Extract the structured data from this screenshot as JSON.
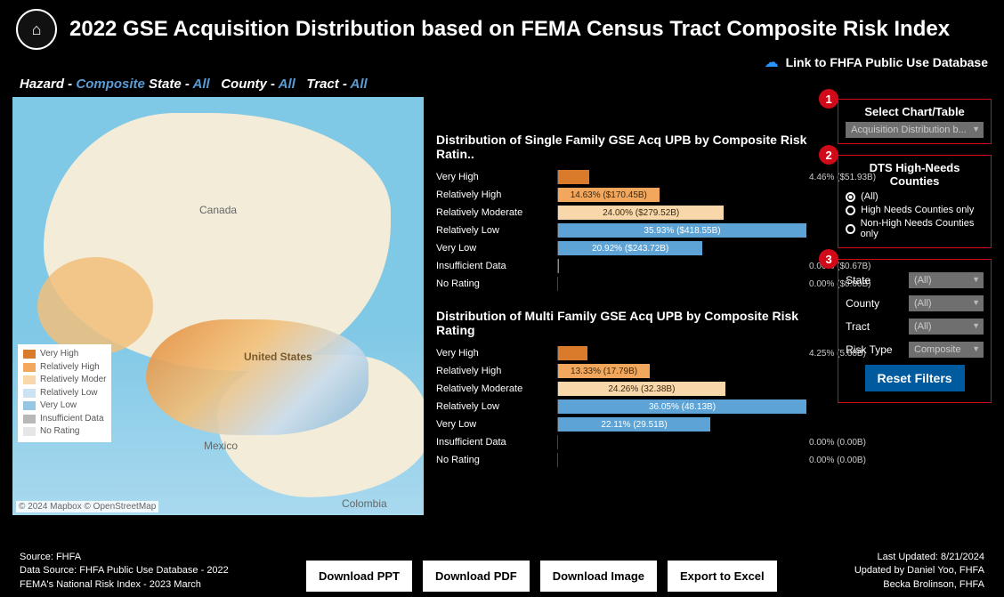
{
  "header": {
    "title": "2022 GSE Acquisition Distribution based on FEMA Census Tract Composite Risk Index",
    "link_label": "Link to FHFA Public Use Database"
  },
  "breadcrumb": {
    "hazard_lbl": "Hazard -",
    "hazard_val": "Composite",
    "state_lbl": "State -",
    "state_val": "All",
    "county_lbl": "County -",
    "county_val": "All",
    "tract_lbl": "Tract -",
    "tract_val": "All"
  },
  "map": {
    "labels": {
      "canada": "Canada",
      "usa": "United States",
      "mexico": "Mexico",
      "colombia": "Colombia"
    },
    "legend": [
      "Very High",
      "Relatively High",
      "Relatively Moder",
      "Relatively Low",
      "Very Low",
      "Insufficient Data",
      "No Rating"
    ],
    "legend_colors": [
      "#d97b2b",
      "#f2a75d",
      "#f8d7aa",
      "#cde3f1",
      "#96c6e4",
      "#b8b8b8",
      "#e6e6e6"
    ],
    "attrib": "© 2024 Mapbox  © OpenStreetMap"
  },
  "chart_data": [
    {
      "type": "bar",
      "title": "Distribution of Single Family GSE Acq UPB by Composite Risk Ratin..",
      "categories": [
        "Very High",
        "Relatively High",
        "Relatively Moderate",
        "Relatively Low",
        "Very Low",
        "Insufficient Data",
        "No Rating"
      ],
      "percent": [
        4.46,
        14.63,
        24.0,
        35.93,
        20.92,
        0.06,
        0.0
      ],
      "amount_b": [
        51.93,
        170.45,
        279.52,
        418.55,
        243.72,
        0.67,
        0.0
      ],
      "colors": [
        "#d97b2b",
        "#f2a75d",
        "#f8d7aa",
        "#5ea3d6",
        "#5ea3d6",
        "#888",
        "#888"
      ],
      "labels": [
        "4.46% ($51.93B)",
        "14.63% ($170.45B)",
        "24.00% ($279.52B)",
        "35.93% ($418.55B)",
        "20.92% ($243.72B)",
        "0.06% ($0.67B)",
        "0.00% ($0.00B)"
      ]
    },
    {
      "type": "bar",
      "title": "Distribution of Multi Family GSE Acq UPB by Composite Risk Rating",
      "categories": [
        "Very High",
        "Relatively High",
        "Relatively Moderate",
        "Relatively Low",
        "Very Low",
        "Insufficient Data",
        "No Rating"
      ],
      "percent": [
        4.25,
        13.33,
        24.26,
        36.05,
        22.11,
        0.0,
        0.0
      ],
      "amount_b": [
        5.68,
        17.79,
        32.38,
        48.13,
        29.51,
        0.0,
        0.0
      ],
      "colors": [
        "#d97b2b",
        "#f2a75d",
        "#f8d7aa",
        "#5ea3d6",
        "#5ea3d6",
        "#888",
        "#888"
      ],
      "labels": [
        "4.25% (5.68B)",
        "13.33% (17.79B)",
        "24.26% (32.38B)",
        "36.05% (48.13B)",
        "22.11% (29.51B)",
        "0.00% (0.00B)",
        "0.00% (0.00B)"
      ]
    }
  ],
  "panels": {
    "select_title": "Select Chart/Table",
    "select_value": "Acquisition Distribution b...",
    "dts_title": "DTS High-Needs Counties",
    "dts_options": [
      "(All)",
      "High Needs Counties only",
      "Non-High Needs Counties only"
    ],
    "dts_selected": 0,
    "filters": {
      "state_lbl": "State",
      "state_val": "(All)",
      "county_lbl": "County",
      "county_val": "(All)",
      "tract_lbl": "Tract",
      "tract_val": "(All)",
      "risktype_lbl": "Risk Type",
      "risktype_val": "Composite"
    },
    "reset_label": "Reset Filters"
  },
  "footer": {
    "source1": "Source:  FHFA",
    "source2": "Data Source: FHFA Public Use Database -  2022",
    "source3": "FEMA's National Risk Index - 2023 March",
    "btns": [
      "Download PPT",
      "Download PDF",
      "Download Image",
      "Export to Excel"
    ],
    "updated": "Last Updated: 8/21/2024",
    "by1": "Updated by Daniel Yoo, FHFA",
    "by2": "Becka Brolinson, FHFA"
  }
}
